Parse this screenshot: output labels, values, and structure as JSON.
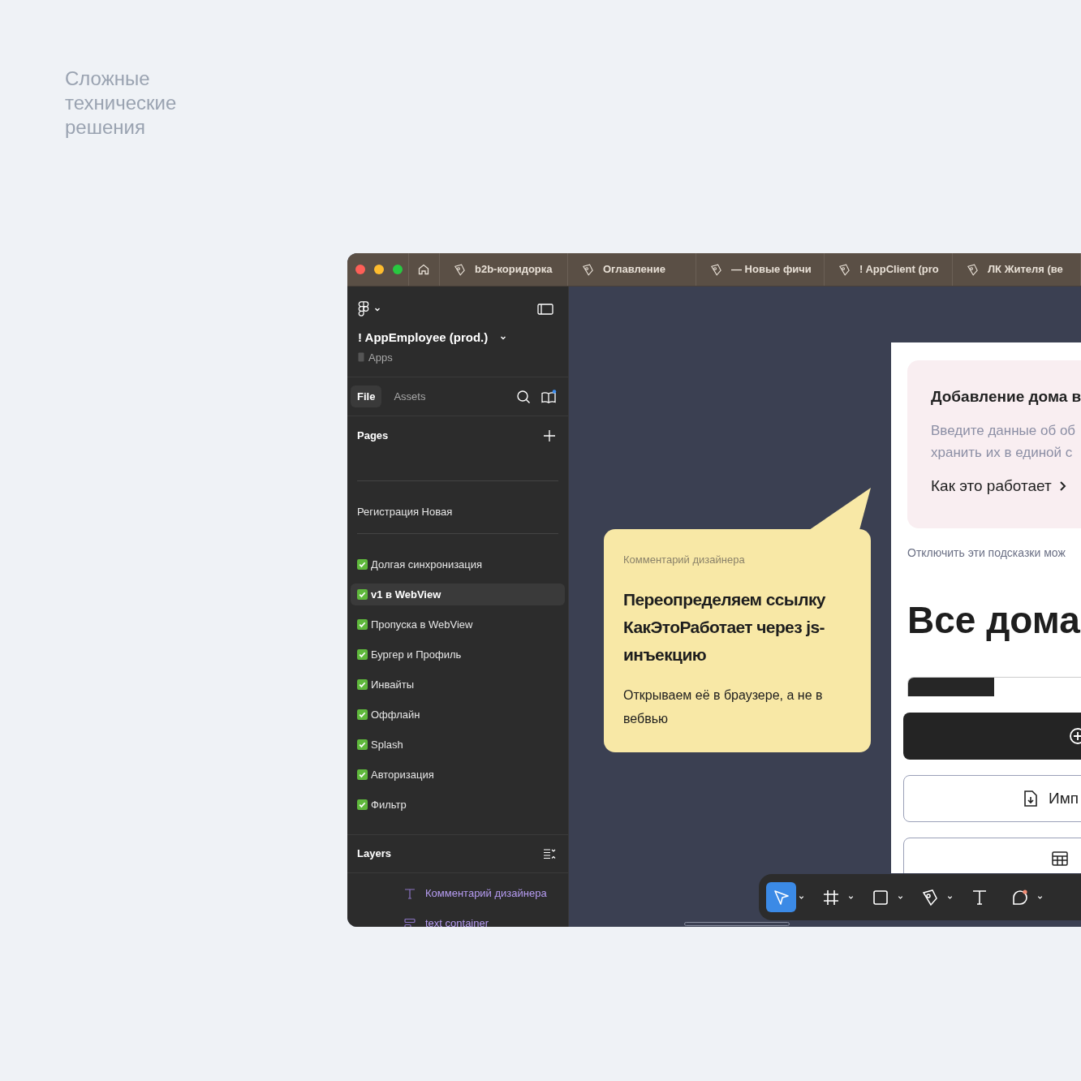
{
  "heading": "Сложные технические решения",
  "window": {
    "tabs": [
      {
        "label": "b2b-коридорка",
        "selected": false
      },
      {
        "label": "Оглавление",
        "selected": false
      },
      {
        "label": "— Новые фичи",
        "selected": false
      },
      {
        "label": "! AppClient (pro",
        "selected": false
      },
      {
        "label": "ЛК Жителя (ве",
        "selected": false
      }
    ]
  },
  "sidebar": {
    "file_title": "! AppEmployee (prod.)",
    "project": "Apps",
    "tabs": [
      {
        "label": "File",
        "selected": true
      },
      {
        "label": "Assets",
        "selected": false
      }
    ],
    "pages_title": "Pages",
    "pages": [
      {
        "kind": "divider"
      },
      {
        "kind": "page",
        "label": "Регистрация Новая",
        "checked": false,
        "selected": false
      },
      {
        "kind": "divider"
      },
      {
        "kind": "page",
        "label": "Долгая синхронизация",
        "checked": true,
        "selected": false
      },
      {
        "kind": "page",
        "label": "v1 в WebView",
        "checked": true,
        "selected": true
      },
      {
        "kind": "page",
        "label": "Пропуска в WebView",
        "checked": true,
        "selected": false
      },
      {
        "kind": "page",
        "label": "Бургер и Профиль",
        "checked": true,
        "selected": false
      },
      {
        "kind": "page",
        "label": "Инвайты",
        "checked": true,
        "selected": false
      },
      {
        "kind": "page",
        "label": "Оффлайн",
        "checked": true,
        "selected": false
      },
      {
        "kind": "page",
        "label": "Splash",
        "checked": true,
        "selected": false
      },
      {
        "kind": "page",
        "label": "Авторизация",
        "checked": true,
        "selected": false
      },
      {
        "kind": "page",
        "label": "Фильтр",
        "checked": true,
        "selected": false
      }
    ],
    "layers_title": "Layers",
    "layers": [
      {
        "kind": "text",
        "label": "Комментарий дизайнера"
      },
      {
        "kind": "frame",
        "label": "text container"
      }
    ]
  },
  "comment": {
    "label": "Комментарий дизайнера",
    "title": "Переопределяем ссылку КакЭтоРаботает через js-инъекцию",
    "body": "Открываем её в браузере, а не в вебвью"
  },
  "frame": {
    "hint_title": "Добавление дома в",
    "hint_text": "Введите данные об об хранить их в единой с",
    "hint_link": "Как это работает",
    "hint_footer": "Отключить эти подсказки мож",
    "title": "Все дома",
    "buttons": [
      {
        "kind": "primary"
      },
      {
        "kind": "import",
        "label": "Имп"
      },
      {
        "kind": "table"
      }
    ]
  },
  "toolbar": [
    {
      "kind": "move",
      "selected": true
    },
    {
      "kind": "frame",
      "selected": false
    },
    {
      "kind": "rect",
      "selected": false
    },
    {
      "kind": "pen",
      "selected": false
    },
    {
      "kind": "text",
      "selected": false
    },
    {
      "kind": "comment",
      "selected": false
    }
  ]
}
